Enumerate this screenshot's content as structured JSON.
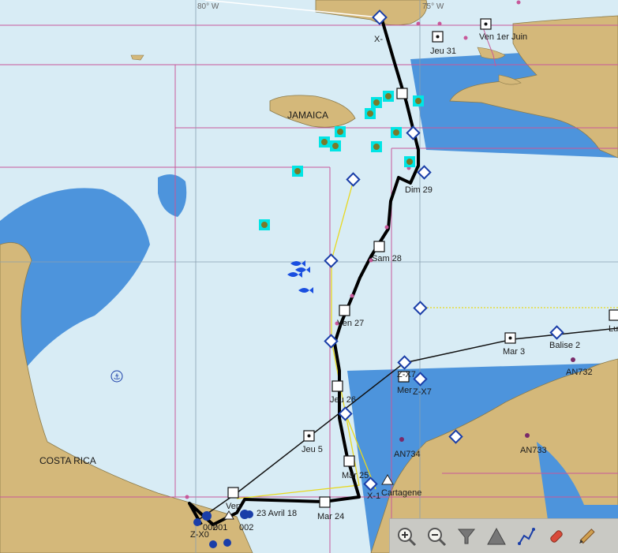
{
  "grid": {
    "lon_80": "80° W",
    "lon_75": "75° W"
  },
  "places": {
    "jamaica": "JAMAICA",
    "costa_rica": "COSTA RICA",
    "cartagene": "Cartagene"
  },
  "route_labels": {
    "ven1": "Ven 1er Juin",
    "jeu31": "Jeu 31",
    "dim29": "Dim 29",
    "sam28": "Sam 28",
    "ven27": "Ven 27",
    "jeu26": "Jeu 26",
    "mer25": "Mar 25",
    "mar24": "Mar 24",
    "avr18": "23 Avril 18",
    "ven": "Ven",
    "jeu5": "Jeu 5",
    "mar3": "Mar 3",
    "mer": "Mer",
    "lu": "Lu"
  },
  "waypoints": {
    "x_top": "X-",
    "balise2": "Balise 2",
    "zx7a": "Z-X7",
    "zx7b": "Z-X7",
    "x1": "X-1",
    "zx0": "Z-X0",
    "p001": "001",
    "p002": "002",
    "p002b": "002"
  },
  "buoys": {
    "an732": "AN732",
    "an733": "AN733",
    "an734": "AN734"
  },
  "toolbar": {
    "zoom_in": "zoom-in",
    "zoom_out": "zoom-out",
    "filter": "filter",
    "warning": "warning",
    "route": "route",
    "marker": "marker",
    "pencil": "pencil"
  },
  "colors": {
    "sea": "#d8ecf5",
    "land": "#d4b87a",
    "shallow": "#4d94dc",
    "grid": "#c7589a",
    "track": "#000000",
    "leg": "#e8d81f",
    "waypoint": "#1a3ea8"
  }
}
